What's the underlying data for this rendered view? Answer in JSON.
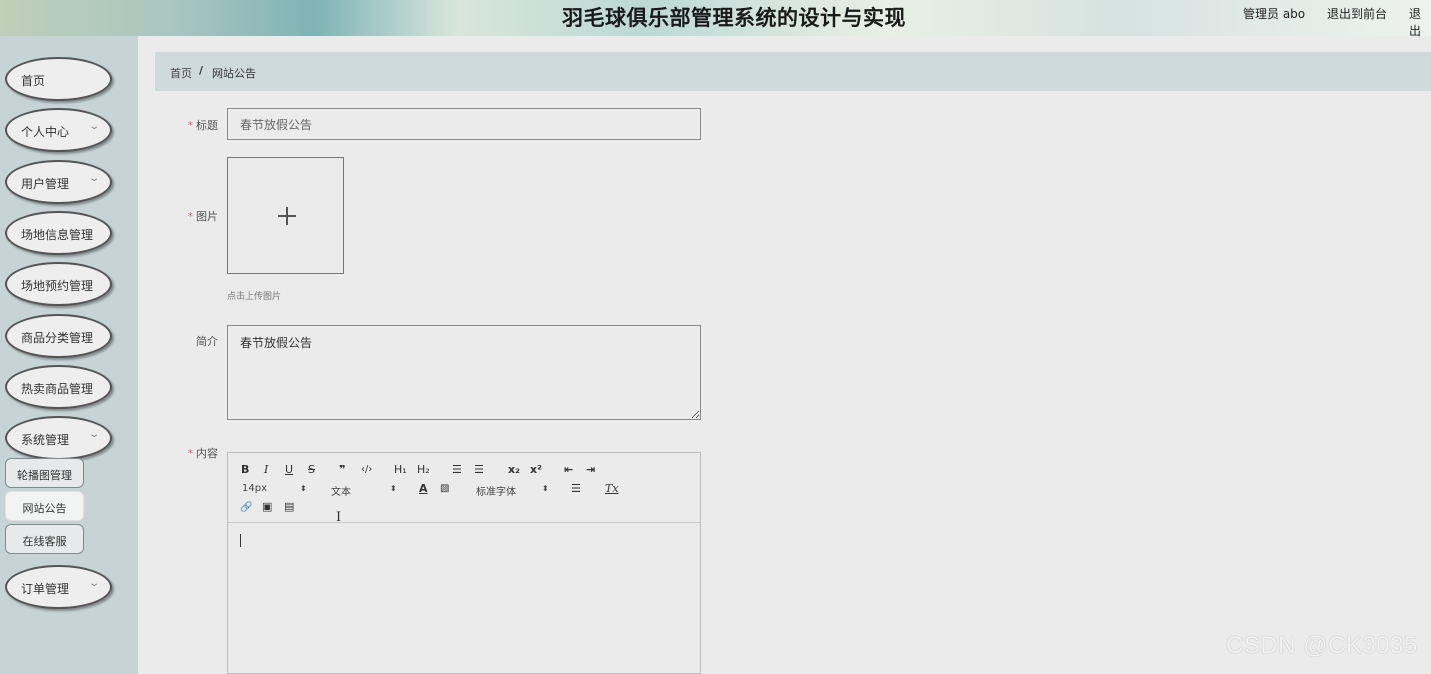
{
  "header": {
    "title": "羽毛球俱乐部管理系统的设计与实现",
    "user": "管理员 abo",
    "back_to_front": "退出到前台",
    "logout": "退出"
  },
  "sidebar": {
    "items": [
      {
        "label": "首页"
      },
      {
        "label": "个人中心"
      },
      {
        "label": "用户管理"
      },
      {
        "label": "场地信息管理"
      },
      {
        "label": "场地预约管理"
      },
      {
        "label": "商品分类管理"
      },
      {
        "label": "热卖商品管理"
      },
      {
        "label": "系统管理"
      },
      {
        "label": "订单管理"
      }
    ],
    "sub_items": [
      {
        "label": "轮播图管理"
      },
      {
        "label": "网站公告"
      },
      {
        "label": "在线客服"
      }
    ]
  },
  "breadcrumb": {
    "home": "首页",
    "separator": "/",
    "current": "网站公告"
  },
  "form": {
    "title_label": "标题",
    "title_value": "春节放假公告",
    "image_label": "图片",
    "upload_tip": "点击上传图片",
    "intro_label": "简介",
    "intro_value": "春节放假公告",
    "content_label": "内容",
    "required_mark": "*"
  },
  "editor": {
    "font_size": "14px",
    "header_select": "文本",
    "font_family": "标准字体",
    "buttons": {
      "bold": "B",
      "italic": "I",
      "underline": "U",
      "strike": "S",
      "quote": "❞",
      "code": "‹/›",
      "h1": "H₁",
      "h2": "H₂",
      "ordered_list": "☰",
      "bullet_list": "☰",
      "sub": "x₂",
      "sup": "x²",
      "outdent": "⇤",
      "indent": "⇥",
      "color": "A",
      "background": "▧",
      "align": "☰",
      "clean": "Tx",
      "link": "🔗",
      "image": "▣",
      "video": "▤"
    }
  },
  "watermark": "CSDN @CK3035"
}
